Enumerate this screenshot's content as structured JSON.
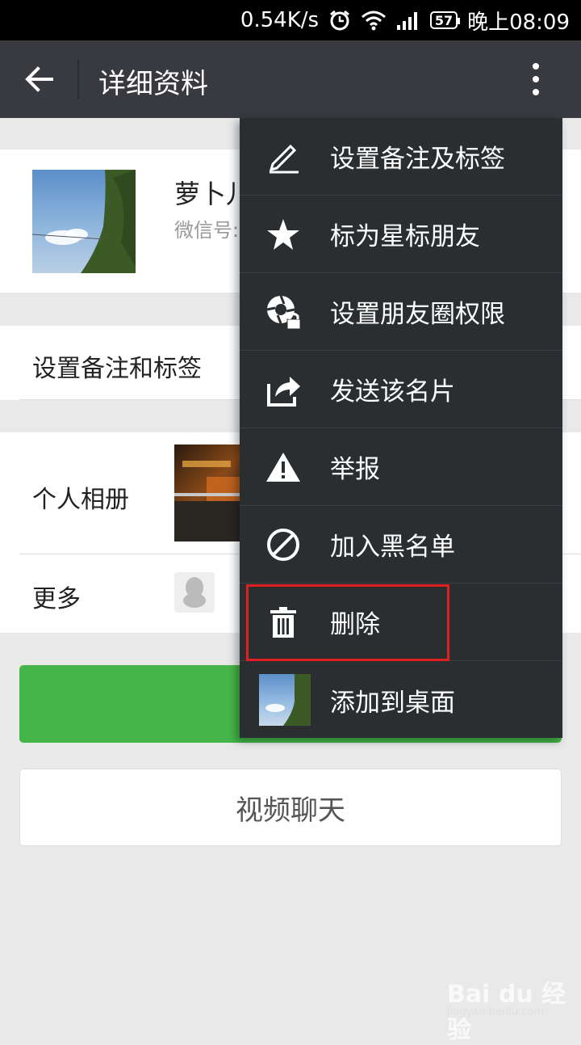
{
  "status_bar": {
    "speed": "0.54K/s",
    "battery": "57",
    "time": "晚上08:09"
  },
  "topbar": {
    "title": "详细资料"
  },
  "profile": {
    "name": "萝卜儿",
    "wechat_id": "微信号:"
  },
  "remark_row": {
    "label": "设置备注和标签"
  },
  "album_row": {
    "label": "个人相册"
  },
  "more_row": {
    "label": "更多"
  },
  "video_chat": {
    "label": "视频聊天"
  },
  "menu": {
    "items": [
      {
        "label": "设置备注及标签",
        "icon": "pencil-icon"
      },
      {
        "label": "标为星标朋友",
        "icon": "star-icon"
      },
      {
        "label": "设置朋友圈权限",
        "icon": "moments-lock-icon"
      },
      {
        "label": "发送该名片",
        "icon": "share-icon"
      },
      {
        "label": "举报",
        "icon": "warning-icon"
      },
      {
        "label": "加入黑名单",
        "icon": "block-icon"
      },
      {
        "label": "删除",
        "icon": "trash-icon"
      },
      {
        "label": "添加到桌面",
        "icon": "avatar-thumbnail"
      }
    ]
  },
  "watermark": {
    "logo": "Bai du 经验",
    "url": "jingyan.baidu.com"
  },
  "colors": {
    "topbar": "#393a3f",
    "menu": "#2b2e31",
    "green": "#44b549",
    "highlight": "#e02020"
  }
}
